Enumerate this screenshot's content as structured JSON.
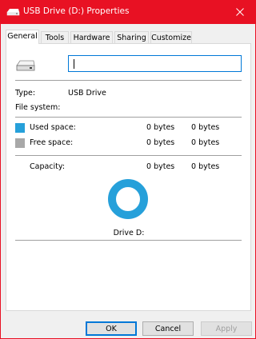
{
  "window": {
    "title": "USB Drive (D:) Properties",
    "accent_color": "#e81123",
    "icons": {
      "title": "usb-drive-icon",
      "close": "close-icon"
    }
  },
  "tabs": [
    {
      "label": "General",
      "active": true
    },
    {
      "label": "Tools",
      "active": false
    },
    {
      "label": "Hardware",
      "active": false
    },
    {
      "label": "Sharing",
      "active": false
    },
    {
      "label": "Customize",
      "active": false
    }
  ],
  "general": {
    "drive_name_value": "",
    "drive_icon": "usb-drive-icon",
    "type_label": "Type:",
    "type_value": "USB Drive",
    "filesystem_label": "File system:",
    "filesystem_value": "",
    "used": {
      "label": "Used space:",
      "bytes": "0 bytes",
      "human": "0 bytes",
      "color": "#26a0da"
    },
    "free": {
      "label": "Free space:",
      "bytes": "0 bytes",
      "human": "0 bytes",
      "color": "#a8a8a8"
    },
    "capacity": {
      "label": "Capacity:",
      "bytes": "0 bytes",
      "human": "0 bytes"
    },
    "chart": {
      "used_fraction": 1.0,
      "caption": "Drive D:"
    }
  },
  "buttons": {
    "ok": "OK",
    "cancel": "Cancel",
    "apply": "Apply"
  }
}
